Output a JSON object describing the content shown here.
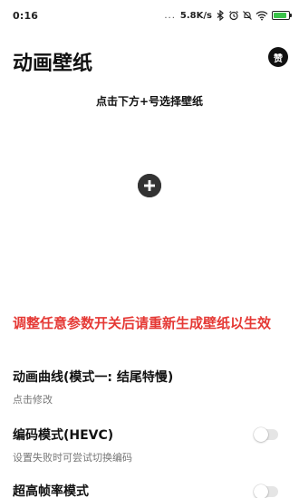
{
  "status_bar": {
    "time": "0:16",
    "dots": "...",
    "net_speed": "5.8K/s",
    "icons": [
      "bluetooth-icon",
      "alarm-icon",
      "mute-icon",
      "wifi-icon",
      "battery-icon"
    ],
    "battery_level": 0.9,
    "battery_color": "#3bc34a"
  },
  "header": {
    "title": "动画壁纸",
    "like_label": "赞"
  },
  "main": {
    "hint": "点击下方+号选择壁纸",
    "add_icon": "plus-circle-icon"
  },
  "warning": {
    "text": "调整任意参数开关后请重新生成壁纸以生效",
    "color": "#e53935"
  },
  "settings": [
    {
      "title": "动画曲线(模式一: 结尾特慢)",
      "subtitle": "点击修改"
    },
    {
      "title": "编码模式(HEVC)",
      "subtitle": "设置失败时可尝试切换编码",
      "toggle": false
    },
    {
      "title": "超高帧率模式",
      "toggle": false
    }
  ]
}
